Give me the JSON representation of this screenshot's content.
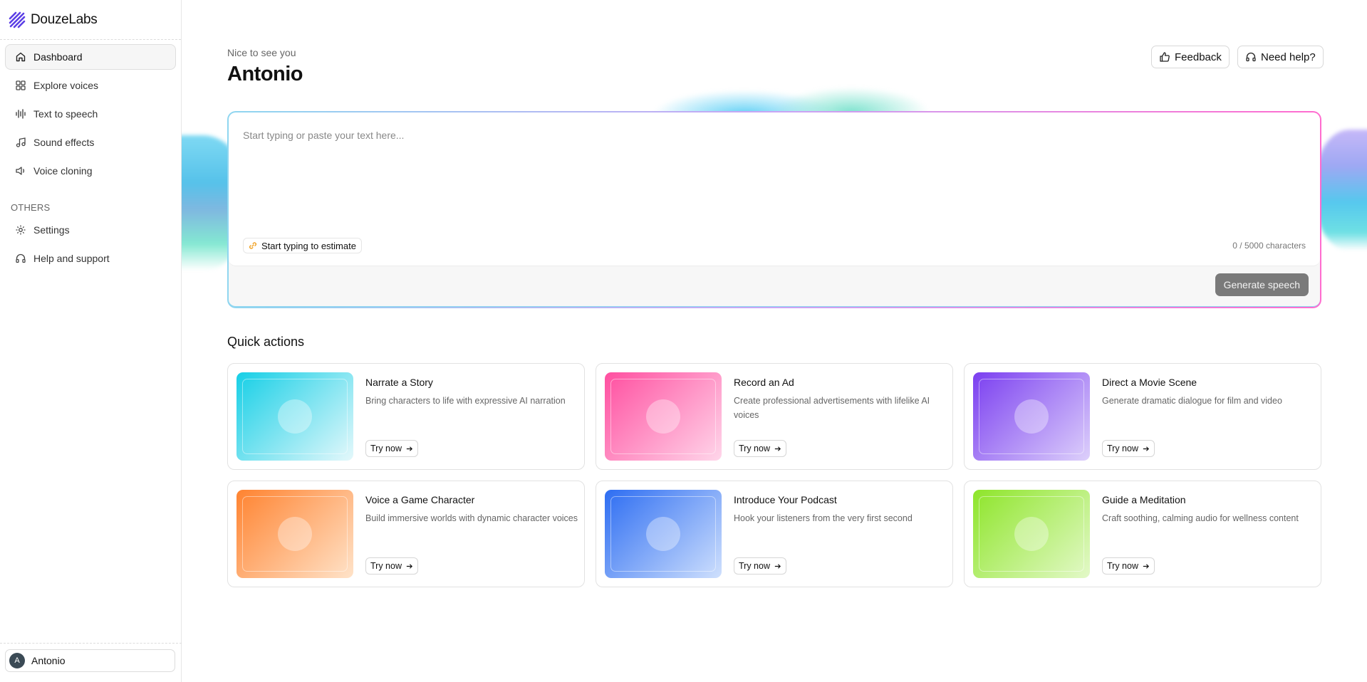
{
  "brand": {
    "name": "DouzeLabs"
  },
  "sidebar": {
    "items": [
      {
        "label": "Dashboard",
        "icon": "home-icon",
        "active": true
      },
      {
        "label": "Explore voices",
        "icon": "grid-icon"
      },
      {
        "label": "Text to speech",
        "icon": "waveform-icon"
      },
      {
        "label": "Sound effects",
        "icon": "music-note-icon"
      },
      {
        "label": "Voice cloning",
        "icon": "speaker-icon"
      }
    ],
    "section_label": "OTHERS",
    "other_items": [
      {
        "label": "Settings",
        "icon": "gear-icon"
      },
      {
        "label": "Help and support",
        "icon": "headphones-icon"
      }
    ],
    "user": {
      "initial": "A",
      "name": "Antonio"
    }
  },
  "header": {
    "greeting": "Nice to see you",
    "username": "Antonio",
    "feedback_label": "Feedback",
    "help_label": "Need help?"
  },
  "editor": {
    "placeholder": "Start typing or paste your text here...",
    "estimate_label": "Start typing to estimate",
    "char_count": "0 / 5000 characters",
    "generate_label": "Generate speech"
  },
  "quick_actions": {
    "title": "Quick actions",
    "cards": [
      {
        "title": "Narrate a Story",
        "desc": "Bring characters to life with expressive AI narration",
        "cta": "Try now",
        "colors": [
          "#16cfe6",
          "#e4f8fb"
        ]
      },
      {
        "title": "Record an Ad",
        "desc": "Create professional advertisements with lifelike AI voices",
        "cta": "Try now",
        "colors": [
          "#ff4fa0",
          "#ffd6ea"
        ]
      },
      {
        "title": "Direct a Movie Scene",
        "desc": "Generate dramatic dialogue for film and video",
        "cta": "Try now",
        "colors": [
          "#7b3ff0",
          "#ddd0fb"
        ]
      },
      {
        "title": "Voice a Game Character",
        "desc": "Build immersive worlds with dynamic character voices",
        "cta": "Try now",
        "colors": [
          "#ff8330",
          "#ffe3c9"
        ]
      },
      {
        "title": "Introduce Your Podcast",
        "desc": "Hook your listeners from the very first second",
        "cta": "Try now",
        "colors": [
          "#2d6df2",
          "#cfe0fd"
        ]
      },
      {
        "title": "Guide a Meditation",
        "desc": "Craft soothing, calming audio for wellness content",
        "cta": "Try now",
        "colors": [
          "#8ee52a",
          "#e3f9c8"
        ]
      }
    ]
  }
}
